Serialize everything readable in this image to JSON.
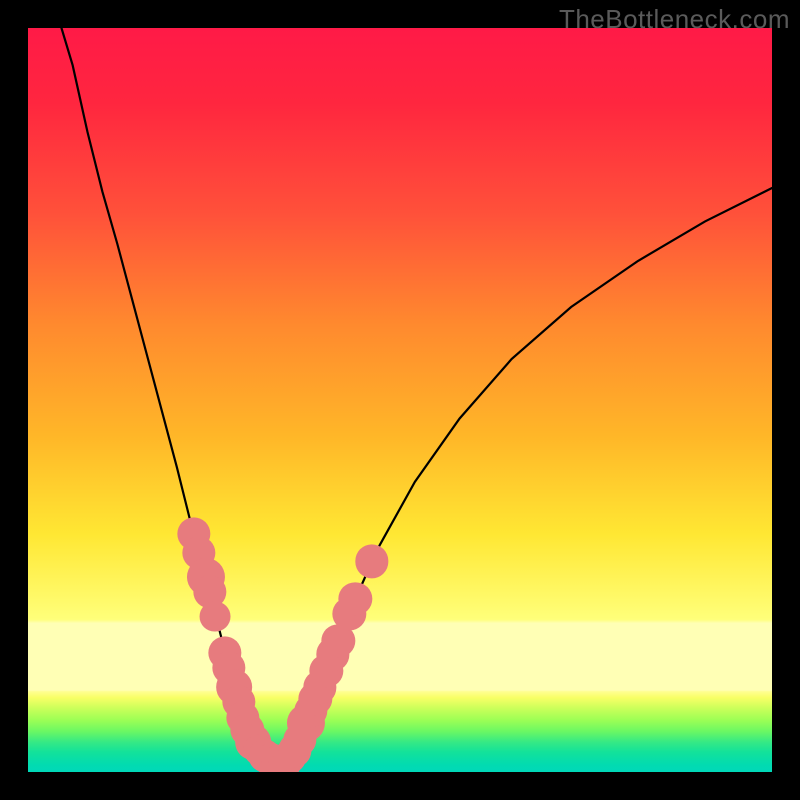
{
  "watermark": "TheBottleneck.com",
  "chart_data": {
    "type": "line",
    "title": "",
    "xlabel": "",
    "ylabel": "",
    "xlim": [
      0,
      100
    ],
    "ylim": [
      0,
      100
    ],
    "series": [
      {
        "name": "left-curve",
        "x": [
          4.5,
          6,
          8,
          10,
          12,
          14,
          16,
          18,
          20,
          22,
          23.5,
          25,
          26,
          27,
          28,
          28.7,
          29.4,
          30,
          30.7,
          31.5,
          32.3,
          33.2,
          34.2
        ],
        "y": [
          100,
          95,
          86,
          78,
          71,
          63.5,
          56,
          48.5,
          41,
          33,
          27.5,
          22,
          18,
          14,
          10.5,
          8,
          6,
          4.7,
          3.6,
          2.7,
          2.0,
          1.5,
          1.2
        ]
      },
      {
        "name": "right-curve",
        "x": [
          34.2,
          35.2,
          36.5,
          38.4,
          40,
          43,
          47,
          52,
          58,
          65,
          73,
          82,
          91,
          100
        ],
        "y": [
          1.2,
          2.0,
          4.3,
          9.0,
          13.5,
          21,
          30,
          39,
          47.5,
          55.5,
          62.5,
          68.7,
          74,
          78.5
        ]
      }
    ],
    "markers": {
      "name": "data-points",
      "points": [
        {
          "x": 22.3,
          "y": 32.0,
          "r": 1.4
        },
        {
          "x": 23.0,
          "y": 29.5,
          "r": 1.4
        },
        {
          "x": 23.9,
          "y": 26.2,
          "r": 1.6
        },
        {
          "x": 24.4,
          "y": 24.2,
          "r": 1.4
        },
        {
          "x": 25.2,
          "y": 20.9,
          "r": 1.3
        },
        {
          "x": 26.5,
          "y": 16.0,
          "r": 1.4
        },
        {
          "x": 27.0,
          "y": 14.0,
          "r": 1.4
        },
        {
          "x": 27.7,
          "y": 11.4,
          "r": 1.5
        },
        {
          "x": 28.3,
          "y": 9.4,
          "r": 1.4
        },
        {
          "x": 28.9,
          "y": 7.3,
          "r": 1.4
        },
        {
          "x": 29.5,
          "y": 5.7,
          "r": 1.4
        },
        {
          "x": 30.3,
          "y": 4.0,
          "r": 1.5
        },
        {
          "x": 31.0,
          "y": 3.0,
          "r": 1.3
        },
        {
          "x": 31.8,
          "y": 2.2,
          "r": 1.4
        },
        {
          "x": 32.7,
          "y": 1.6,
          "r": 1.4
        },
        {
          "x": 33.6,
          "y": 1.3,
          "r": 1.4
        },
        {
          "x": 34.5,
          "y": 1.3,
          "r": 1.4
        },
        {
          "x": 35.2,
          "y": 2.0,
          "r": 1.4
        },
        {
          "x": 35.9,
          "y": 2.9,
          "r": 1.4
        },
        {
          "x": 36.5,
          "y": 4.3,
          "r": 1.4
        },
        {
          "x": 37.4,
          "y": 6.6,
          "r": 1.6
        },
        {
          "x": 38.0,
          "y": 8.2,
          "r": 1.4
        },
        {
          "x": 38.6,
          "y": 9.8,
          "r": 1.4
        },
        {
          "x": 39.2,
          "y": 11.4,
          "r": 1.4
        },
        {
          "x": 40.1,
          "y": 13.6,
          "r": 1.4
        },
        {
          "x": 41.0,
          "y": 15.8,
          "r": 1.4
        },
        {
          "x": 41.7,
          "y": 17.6,
          "r": 1.4
        },
        {
          "x": 43.2,
          "y": 21.3,
          "r": 1.4
        },
        {
          "x": 44.0,
          "y": 23.3,
          "r": 1.4
        },
        {
          "x": 46.2,
          "y": 28.3,
          "r": 1.4
        }
      ]
    },
    "colors": {
      "curve": "#000000",
      "marker": "#e77b7e",
      "gradient_top": "#ff1a47",
      "gradient_mid": "#ffe733",
      "gradient_bottom": "#00d8b9"
    }
  }
}
